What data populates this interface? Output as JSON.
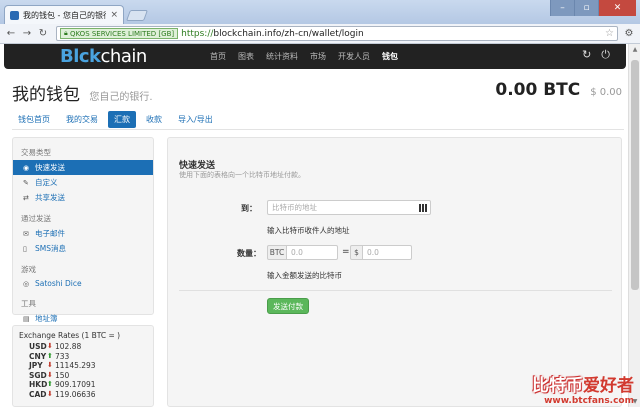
{
  "browser": {
    "tab_title": "我的钱包 - 您自己的银行",
    "ev_badge": "QKOS SERVICES LIMITED [GB]",
    "url_scheme": "https://",
    "url_rest": "blockchain.info/zh-cn/wallet/login"
  },
  "site": {
    "logo_block": "Bl",
    "logo_mid": "ck",
    "logo_rest": "chain",
    "nav": [
      "首页",
      "图表",
      "统计资料",
      "市场",
      "开发人员",
      "钱包"
    ]
  },
  "wallet": {
    "title": "我的钱包",
    "subtitle": "您自己的银行.",
    "balance_btc": "0.00 BTC",
    "balance_usd": "$ 0.00"
  },
  "tabs": [
    "钱包首页",
    "我的交易",
    "汇款",
    "收款",
    "导入/导出"
  ],
  "sidebar": {
    "section1": "交易类型",
    "items1": [
      "快速发送",
      "自定义",
      "共享发送"
    ],
    "section2": "通过发送",
    "items2": [
      "电子邮件",
      "SMS消息"
    ],
    "section3": "游戏",
    "items3": [
      "Satoshi Dice"
    ],
    "section4": "工具",
    "items4": [
      "地址簿"
    ]
  },
  "rates": {
    "header": "Exchange Rates (1 BTC = )",
    "rows": [
      {
        "cur": "USD",
        "dir": "down",
        "val": "102.88"
      },
      {
        "cur": "CNY",
        "dir": "up",
        "val": "733"
      },
      {
        "cur": "JPY",
        "dir": "down",
        "val": "11145.293"
      },
      {
        "cur": "SGD",
        "dir": "down",
        "val": "150"
      },
      {
        "cur": "HKD",
        "dir": "up",
        "val": "909.17091"
      },
      {
        "cur": "CAD",
        "dir": "down",
        "val": "119.06636"
      }
    ]
  },
  "form": {
    "title": "快速发送",
    "subtitle": "使用下面的表格向一个比特币地址付款。",
    "to_label": "到：",
    "to_placeholder": "比特币的地址",
    "to_hint": "输入比特币收件人的地址",
    "amount_label": "数量：",
    "btc_addon": "BTC",
    "btc_value": "0.0",
    "eq": "=",
    "usd_addon": "$",
    "usd_value": "0.0",
    "amount_hint": "输入金额发送的比特币",
    "send_button": "发送付款"
  },
  "watermark": {
    "line1a": "比特币",
    "line1b": "爱好者",
    "line2": "www.btcfans.com"
  }
}
